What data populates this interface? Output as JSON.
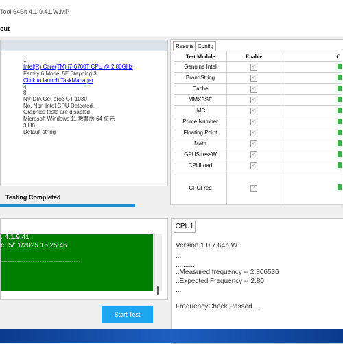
{
  "window": {
    "title": "Tool 64Bit 4.1.9.41.W.MP"
  },
  "menu": {
    "about": "out"
  },
  "info": {
    "lines": [
      "1",
      "Intel(R) Core(TM) i7-6700T CPU @ 2.80GHz",
      "Family 6 Model 5E Stepping 3",
      "Click to launch TaskManager",
      "4",
      "8",
      "NVIDIA GeForce GT 1030",
      "No. Non-Intel GPU Detected.",
      "Graphics tests are disabled",
      "Microsoft Windows 11 教育版 64 位元",
      "3.H0",
      "Default string"
    ]
  },
  "status": {
    "text": "Testing Completed",
    "progress": 1.0
  },
  "log": {
    "lines": [
      ". 4.1.9.41",
      "e: 5/11/2025 16:25:46",
      "",
      "-----------------------------------"
    ]
  },
  "start_button": {
    "label": "Start Test"
  },
  "tabs": {
    "results": "Results",
    "config": "Config"
  },
  "table": {
    "headers": [
      "Test Module",
      "Enable",
      "C"
    ],
    "rows": [
      {
        "module": "Genuine Intel",
        "enabled": true
      },
      {
        "module": "BrandString",
        "enabled": true
      },
      {
        "module": "Cache",
        "enabled": true
      },
      {
        "module": "MMXSSE",
        "enabled": true
      },
      {
        "module": "IMC",
        "enabled": true
      },
      {
        "module": "Prime Number",
        "enabled": true
      },
      {
        "module": "Floating Point",
        "enabled": true
      },
      {
        "module": "Math",
        "enabled": true
      },
      {
        "module": "GPUStressW",
        "enabled": true
      },
      {
        "module": "CPULoad",
        "enabled": true
      },
      {
        "module": "CPUFreq",
        "enabled": true
      }
    ]
  },
  "cpu": {
    "tab": "CPU1",
    "lines": [
      "Version 1.0.7.64b.W",
      "...",
      "..........",
      "..Measured frequency -- 2.806536",
      "..Expected Frequency -- 2.80",
      "...",
      "",
      "FrequencyCheck Passed...."
    ]
  },
  "colors": {
    "accent": "#1ea7f0",
    "log_bg": "#008000",
    "progress": "#1e90d2"
  }
}
